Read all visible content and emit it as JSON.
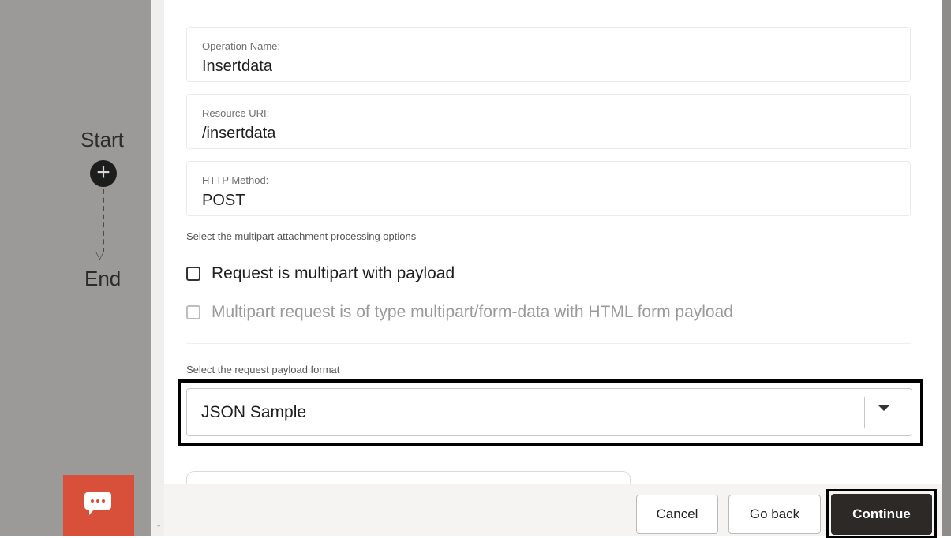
{
  "flow": {
    "start_label": "Start",
    "end_label": "End"
  },
  "form": {
    "operation_name": {
      "label": "Operation Name:",
      "value": "Insertdata"
    },
    "resource_uri": {
      "label": "Resource URI:",
      "value": "/insertdata"
    },
    "http_method": {
      "label": "HTTP Method:",
      "value": "POST"
    },
    "multipart_section_label": "Select the multipart attachment processing options",
    "checkbox_multipart": {
      "label": "Request is multipart with payload",
      "checked": false
    },
    "checkbox_formdata": {
      "label": "Multipart request is of type multipart/form-data with HTML form payload",
      "checked": false,
      "disabled": true
    },
    "payload_format_label": "Select the request payload format",
    "payload_format_value": "JSON Sample"
  },
  "footer": {
    "cancel_label": "Cancel",
    "goback_label": "Go back",
    "continue_label": "Continue"
  },
  "icons": {
    "chat": "chat-icon",
    "add": "plus-circle-icon",
    "dropdown": "caret-down-icon"
  },
  "colors": {
    "chat_button": "#d9503a",
    "primary_button": "#2d2926",
    "left_panel": "#9c9a98"
  }
}
